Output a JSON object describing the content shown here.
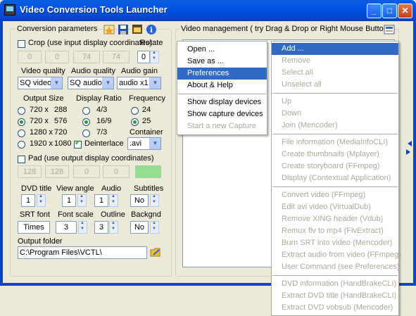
{
  "window": {
    "title": "Video Conversion Tools Launcher"
  },
  "conversion": {
    "group_label": "Conversion parameters",
    "crop_label": "Crop (use input display coordinates)",
    "crop_values": [
      "0",
      "0",
      "74",
      "74"
    ],
    "rotate_label": "Rotate",
    "rotate_value": "0",
    "video_quality_label": "Video quality",
    "video_quality_value": "SQ video",
    "audio_quality_label": "Audio quality",
    "audio_quality_value": "SQ audio",
    "audio_gain_label": "Audio gain",
    "audio_gain_value": "audio x1",
    "output_size_label": "Output  Size",
    "sizes": [
      {
        "w": "720 x",
        "h": "288",
        "selected": false
      },
      {
        "w": "720 x",
        "h": "576",
        "selected": true
      },
      {
        "w": "1280 x",
        "h": "720",
        "selected": false
      },
      {
        "w": "1920 x",
        "h": "1080",
        "selected": false
      }
    ],
    "display_ratio_label": "Display Ratio",
    "ratios": [
      {
        "label": "4/3",
        "selected": false
      },
      {
        "label": "16/9",
        "selected": true
      },
      {
        "label": "7/3",
        "selected": false
      }
    ],
    "deinterlace_label": "Deinterlace",
    "frequency_label": "Frequency",
    "frequencies": [
      {
        "label": "24",
        "selected": false
      },
      {
        "label": "25",
        "selected": true
      }
    ],
    "container_label": "Container",
    "container_value": ".avi",
    "pad_label": "Pad (use output display coordinates)",
    "pad_values": [
      "128",
      "128",
      "0",
      "0"
    ],
    "pad_color": "#90E090",
    "dvd_title_label": "DVD title",
    "dvd_title_value": "1",
    "view_angle_label": "View angle",
    "view_angle_value": "1",
    "audio_label": "Audio",
    "audio_value": "1",
    "subtitles_label": "Subtitles",
    "subtitles_value": "No",
    "srt_font_label": "SRT font",
    "srt_font_value": "Times",
    "font_scale_label": "Font scale",
    "font_scale_value": "3",
    "outline_label": "Outline",
    "outline_value": "3",
    "backgnd_label": "Backgnd",
    "backgnd_value": "No",
    "output_folder_label": "Output folder",
    "output_folder_value": "C:\\Program Files\\VCTL\\"
  },
  "video_management": {
    "group_label": "Video management ( try Drag & Drop or Right Mouse Button )"
  },
  "left_menu": {
    "items": [
      {
        "label": "Open ...",
        "state": "normal"
      },
      {
        "label": "Save as ...",
        "state": "normal"
      },
      {
        "label": "Preferences",
        "state": "highlight"
      },
      {
        "label": "About & Help",
        "state": "normal"
      },
      {
        "sep": true
      },
      {
        "label": "Show display devices",
        "state": "normal"
      },
      {
        "label": "Show capture devices",
        "state": "normal"
      },
      {
        "label": "Start a new Capture",
        "state": "disabled"
      }
    ]
  },
  "right_menu": {
    "items": [
      {
        "label": "Add ...",
        "state": "highlight"
      },
      {
        "label": "Remove",
        "state": "disabled"
      },
      {
        "label": "Select all",
        "state": "disabled"
      },
      {
        "label": "Unselect all",
        "state": "disabled"
      },
      {
        "sep": true
      },
      {
        "label": "Up",
        "state": "disabled"
      },
      {
        "label": "Down",
        "state": "disabled"
      },
      {
        "label": "Join (Mencoder)",
        "state": "disabled"
      },
      {
        "sep": true
      },
      {
        "label": "File information (MediaInfoCLI)",
        "state": "disabled"
      },
      {
        "label": "Create thumbnails (Mplayer)",
        "state": "disabled"
      },
      {
        "label": "Create storyboard (FFmpeg)",
        "state": "disabled"
      },
      {
        "label": "Display (Contextual Application)",
        "state": "disabled"
      },
      {
        "sep": true
      },
      {
        "label": "Convert video (FFmpeg)",
        "state": "disabled"
      },
      {
        "label": "Edit avi video (VirtualDub)",
        "state": "disabled"
      },
      {
        "label": "Remove XING header (Vdub)",
        "state": "disabled"
      },
      {
        "label": "Remux flv to mp4 (FlvExtract)",
        "state": "disabled"
      },
      {
        "label": "Burn SRT into video (Mencoder)",
        "state": "disabled"
      },
      {
        "label": "Extract audio from video (FFmpeg)",
        "state": "disabled"
      },
      {
        "label": "User Command (see Preferences)",
        "state": "disabled"
      },
      {
        "sep": true
      },
      {
        "label": "DVD information (HandBrakeCLI)",
        "state": "disabled"
      },
      {
        "label": "Extract DVD title (HandBrakeCLI)",
        "state": "disabled"
      },
      {
        "label": "Extract DVD vobsub (Mencoder)",
        "state": "disabled"
      }
    ]
  },
  "icons": [
    "app-icon",
    "star-icon",
    "save-icon",
    "film-icon",
    "info-icon",
    "video-manage-icon",
    "folder-icon",
    "arrow-icon"
  ]
}
